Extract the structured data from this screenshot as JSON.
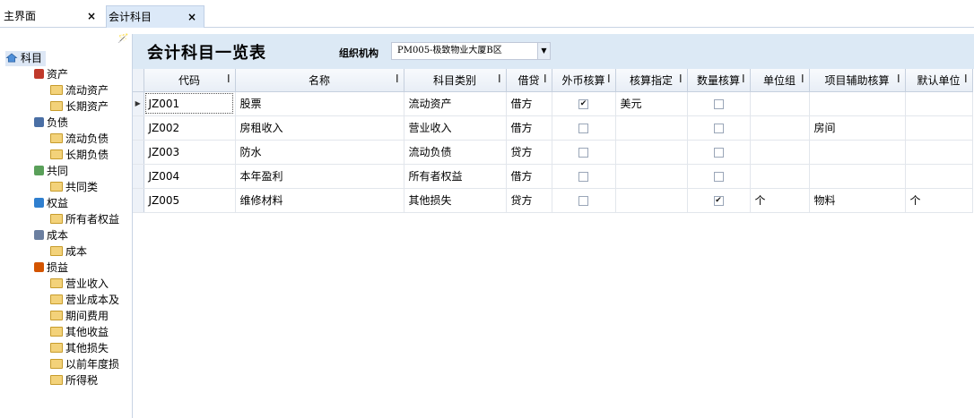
{
  "tabs": [
    {
      "label": "主界面",
      "close": "×"
    },
    {
      "label": "会计科目",
      "close": "×"
    }
  ],
  "tree": {
    "root": "科目",
    "nodes": [
      {
        "label": "资产",
        "level": 1,
        "icon": "asset-icon"
      },
      {
        "label": "流动资产",
        "level": 2,
        "icon": "folder-icon"
      },
      {
        "label": "长期资产",
        "level": 2,
        "icon": "folder-icon"
      },
      {
        "label": "负债",
        "level": 1,
        "icon": "liability-icon"
      },
      {
        "label": "流动负债",
        "level": 2,
        "icon": "folder-icon"
      },
      {
        "label": "长期负债",
        "level": 2,
        "icon": "folder-icon"
      },
      {
        "label": "共同",
        "level": 1,
        "icon": "common-icon"
      },
      {
        "label": "共同类",
        "level": 2,
        "icon": "folder-icon"
      },
      {
        "label": "权益",
        "level": 1,
        "icon": "equity-icon"
      },
      {
        "label": "所有者权益",
        "level": 2,
        "icon": "folder-icon"
      },
      {
        "label": "成本",
        "level": 1,
        "icon": "cost-icon"
      },
      {
        "label": "成本",
        "level": 2,
        "icon": "folder-icon"
      },
      {
        "label": "损益",
        "level": 1,
        "icon": "profit-loss-icon"
      },
      {
        "label": "营业收入",
        "level": 2,
        "icon": "folder-icon"
      },
      {
        "label": "营业成本及",
        "level": 2,
        "icon": "folder-icon"
      },
      {
        "label": "期间费用",
        "level": 2,
        "icon": "folder-icon"
      },
      {
        "label": "其他收益",
        "level": 2,
        "icon": "folder-icon"
      },
      {
        "label": "其他损失",
        "level": 2,
        "icon": "folder-icon"
      },
      {
        "label": "以前年度损",
        "level": 2,
        "icon": "folder-icon"
      },
      {
        "label": "所得税",
        "level": 2,
        "icon": "folder-icon"
      }
    ]
  },
  "header": {
    "title": "会计科目一览表",
    "org_label": "组织机构",
    "org_value": "PM005-极致物业大厦B区"
  },
  "grid": {
    "columns": [
      "代码",
      "名称",
      "科目类别",
      "借贷",
      "外币核算",
      "核算指定",
      "数量核算",
      "单位组",
      "项目辅助核算",
      "默认单位"
    ],
    "rows": [
      {
        "code": "JZ001",
        "name": "股票",
        "category": "流动资产",
        "dc": "借方",
        "fx": true,
        "spec": "美元",
        "qty": false,
        "unit_group": "",
        "aux": "",
        "unit": ""
      },
      {
        "code": "JZ002",
        "name": "房租收入",
        "category": "营业收入",
        "dc": "借方",
        "fx": false,
        "spec": "",
        "qty": false,
        "unit_group": "",
        "aux": "房间",
        "unit": ""
      },
      {
        "code": "JZ003",
        "name": "防水",
        "category": "流动负债",
        "dc": "贷方",
        "fx": false,
        "spec": "",
        "qty": false,
        "unit_group": "",
        "aux": "",
        "unit": ""
      },
      {
        "code": "JZ004",
        "name": "本年盈利",
        "category": "所有者权益",
        "dc": "借方",
        "fx": false,
        "spec": "",
        "qty": false,
        "unit_group": "",
        "aux": "",
        "unit": ""
      },
      {
        "code": "JZ005",
        "name": "维修材料",
        "category": "其他损失",
        "dc": "贷方",
        "fx": false,
        "spec": "",
        "qty": true,
        "unit_group": "个",
        "aux": "物料",
        "unit": "个"
      }
    ]
  }
}
